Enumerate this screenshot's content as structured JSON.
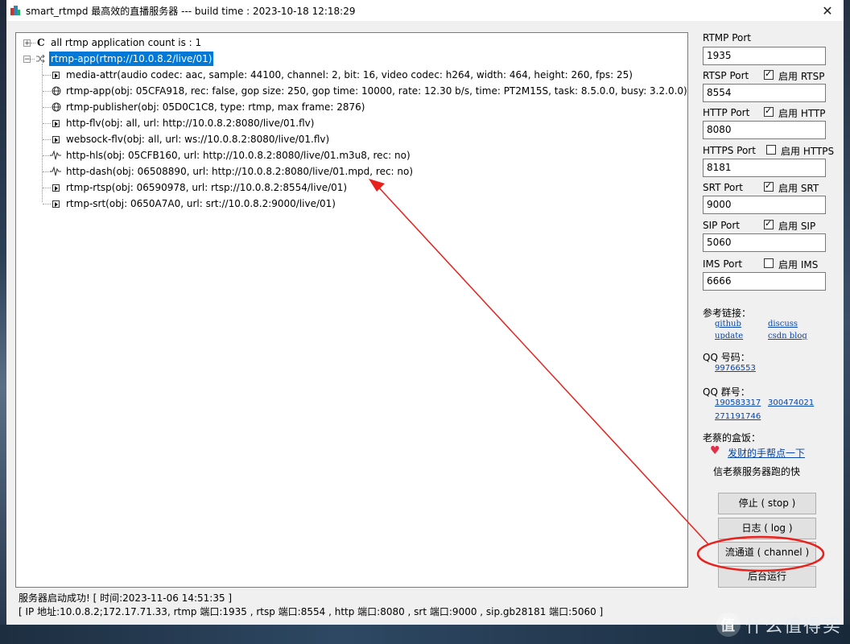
{
  "window": {
    "title": "smart_rtmpd 最高效的直播服务器 --- build time : 2023-10-18 12:18:29",
    "close_glyph": "✕"
  },
  "tree": {
    "root_label": "all rtmp application count is : 1",
    "app_label": "rtmp-app(rtmp://10.0.8.2/live/01)",
    "children": [
      {
        "icon": "leaf-icon",
        "label": "media-attr(audio codec: aac, sample: 44100, channel: 2, bit: 16, video codec: h264, width: 464, height: 260, fps: 25)"
      },
      {
        "icon": "globe-icon",
        "label": "rtmp-app(obj: 05CFA918, rec: false, gop size: 250, gop time: 10000, rate: 12.30 b/s, time: PT2M15S, task: 8.5.0.0, busy: 3.2.0.0)"
      },
      {
        "icon": "globe-icon",
        "label": "rtmp-publisher(obj: 05D0C1C8, type: rtmp, max frame: 2876)"
      },
      {
        "icon": "leaf-icon",
        "label": "http-flv(obj: all, url: http://10.0.8.2:8080/live/01.flv)"
      },
      {
        "icon": "leaf-icon",
        "label": "websock-flv(obj: all, url: ws://10.0.8.2:8080/live/01.flv)"
      },
      {
        "icon": "wave-icon",
        "label": "http-hls(obj: 05CFB160, url: http://10.0.8.2:8080/live/01.m3u8, rec: no)"
      },
      {
        "icon": "wave-icon",
        "label": "http-dash(obj: 06508890, url: http://10.0.8.2:8080/live/01.mpd, rec: no)"
      },
      {
        "icon": "leaf-icon",
        "label": "rtmp-rtsp(obj: 06590978, url: rtsp://10.0.8.2:8554/live/01)"
      },
      {
        "icon": "leaf-icon",
        "label": "rtmp-srt(obj: 0650A7A0, url: srt://10.0.8.2:9000/live/01)"
      }
    ]
  },
  "ports": {
    "rtmp": {
      "label": "RTMP Port",
      "value": "1935"
    },
    "rtsp": {
      "label": "RTSP Port",
      "value": "8554",
      "enable_label": "启用 RTSP",
      "enabled": true
    },
    "http": {
      "label": "HTTP Port",
      "value": "8080",
      "enable_label": "启用 HTTP",
      "enabled": true
    },
    "https": {
      "label": "HTTPS Port",
      "value": "8181",
      "enable_label": "启用 HTTPS",
      "enabled": false
    },
    "srt": {
      "label": "SRT Port",
      "value": "9000",
      "enable_label": "启用 SRT",
      "enabled": true
    },
    "sip": {
      "label": "SIP Port",
      "value": "5060",
      "enable_label": "启用 SIP",
      "enabled": true
    },
    "ims": {
      "label": "IMS Port",
      "value": "6666",
      "enable_label": "启用 IMS",
      "enabled": false
    }
  },
  "links": {
    "title": "参考链接：",
    "github": "github",
    "discuss": "discuss",
    "update": "update",
    "csdn": "csdn blog"
  },
  "qq": {
    "title": "QQ 号码：",
    "number": "99766553",
    "group_title": "QQ 群号：",
    "groups": [
      "190583317",
      "300474021",
      "271191746"
    ]
  },
  "donate": {
    "title": "老蔡的盒饭：",
    "link": "发财的手帮点一下",
    "text": "信老蔡服务器跑的快"
  },
  "buttons": {
    "stop": "停止 ( stop )",
    "log": "日志 ( log )",
    "channel": "流通道 ( channel )",
    "background": "后台运行"
  },
  "status": {
    "line1": "服务器启动成功! [ 时间:2023-11-06 14:51:35 ]",
    "line2": "[ IP 地址:10.0.8.2;172.17.71.33,  rtmp 端口:1935 ,  rtsp 端口:8554 ,  http 端口:8080 ,  srt 端口:9000 ,  sip.gb28181 端口:5060 ]"
  },
  "watermark": {
    "badge": "值",
    "text": "什么值得买"
  },
  "colors": {
    "selection": "#0078d7",
    "annotation": "#e8211c",
    "link": "#0645ad"
  }
}
